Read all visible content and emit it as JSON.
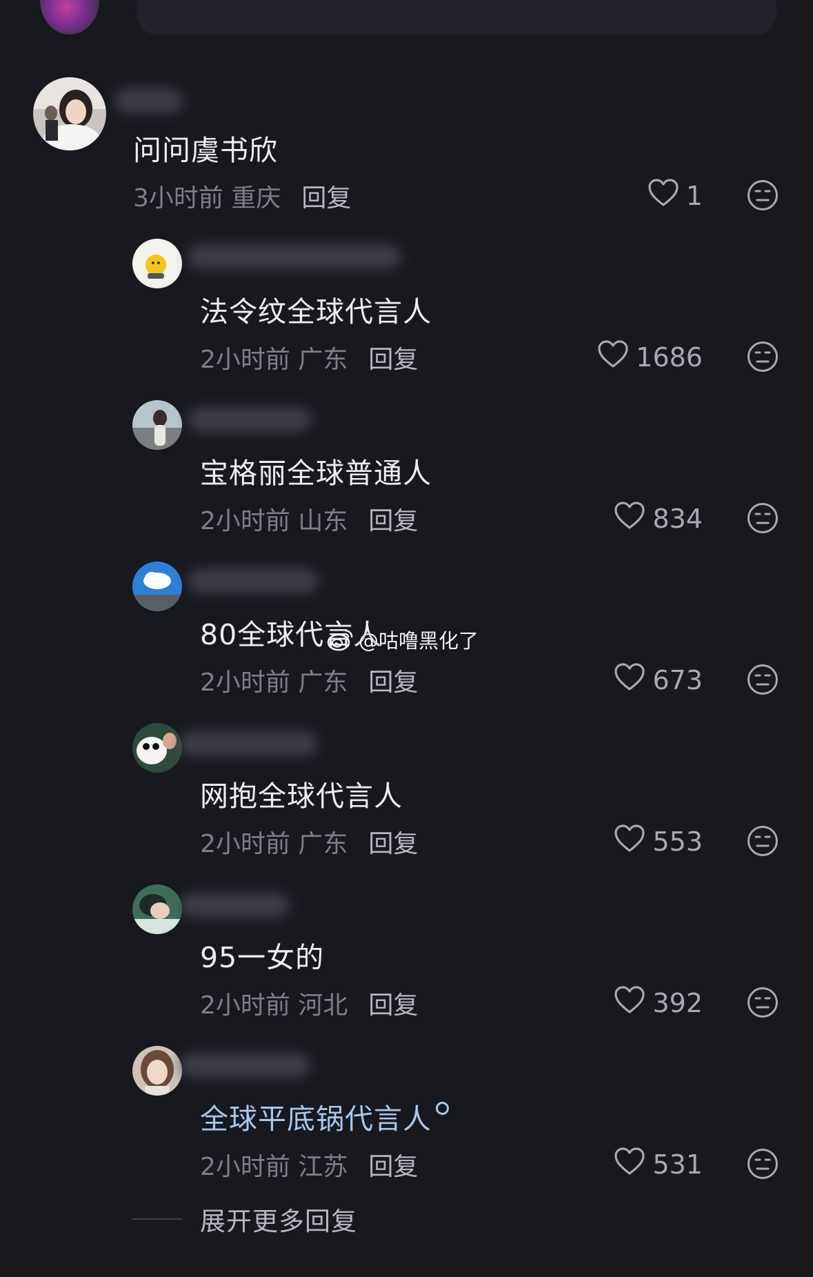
{
  "comments": [
    {
      "content": "问问虞书欣",
      "time": "3小时前",
      "location": "重庆",
      "reply_label": "回复",
      "likes": "1"
    },
    {
      "content": "法令纹全球代言人",
      "time": "2小时前",
      "location": "广东",
      "reply_label": "回复",
      "likes": "1686"
    },
    {
      "content": "宝格丽全球普通人",
      "time": "2小时前",
      "location": "山东",
      "reply_label": "回复",
      "likes": "834"
    },
    {
      "content": "80全球代言人",
      "time": "2小时前",
      "location": "广东",
      "reply_label": "回复",
      "likes": "673"
    },
    {
      "content": "网抱全球代言人",
      "time": "2小时前",
      "location": "广东",
      "reply_label": "回复",
      "likes": "553"
    },
    {
      "content": "95一女的",
      "time": "2小时前",
      "location": "河北",
      "reply_label": "回复",
      "likes": "392"
    },
    {
      "content": "全球平底锅代言人",
      "time": "2小时前",
      "location": "江苏",
      "reply_label": "回复",
      "likes": "531"
    }
  ],
  "expand_more": "展开更多回复",
  "watermark": "@咕噜黑化了",
  "icons": {
    "like": "heart-outline-icon",
    "dislike": "meh-face-icon",
    "search": "search-icon",
    "watermark_logo": "weibo-logo"
  },
  "colors": {
    "background": "#18181f",
    "text_primary": "#eeeef2",
    "text_secondary": "#7e7e88",
    "link_text": "#a8c8ea"
  }
}
